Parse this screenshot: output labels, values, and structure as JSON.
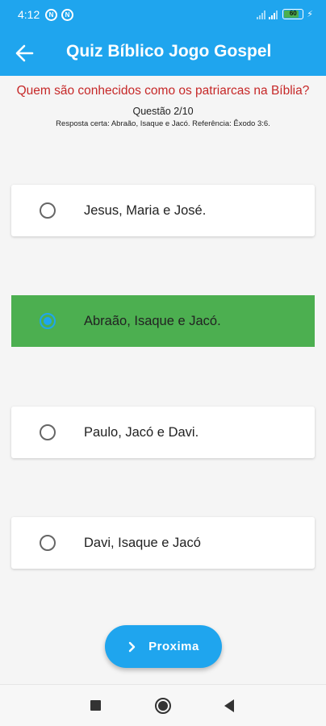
{
  "status_bar": {
    "time": "4:12",
    "notification_icons": [
      "N",
      "N"
    ],
    "battery_level": "60"
  },
  "app_bar": {
    "title": "Quiz Bíblico Jogo Gospel",
    "back_icon": "arrow-left-icon"
  },
  "quiz": {
    "question": "Quem são conhecidos como os patriarcas na Bíblia?",
    "counter": "Questão 2/10",
    "answer_hint": "Resposta certa: Abraão, Isaque e Jacó. Referência: Êxodo 3:6.",
    "options": [
      {
        "label": "Jesus, Maria e José.",
        "selected": false
      },
      {
        "label": "Abraão, Isaque e Jacó.",
        "selected": true
      },
      {
        "label": "Paulo, Jacó e Davi.",
        "selected": false
      },
      {
        "label": "Davi, Isaque e Jacó",
        "selected": false
      }
    ]
  },
  "next_button": {
    "label": "Proxima",
    "icon": "chevron-right-icon"
  },
  "colors": {
    "primary": "#1fa5ee",
    "question_text": "#c62828",
    "correct_option": "#4caf50"
  }
}
